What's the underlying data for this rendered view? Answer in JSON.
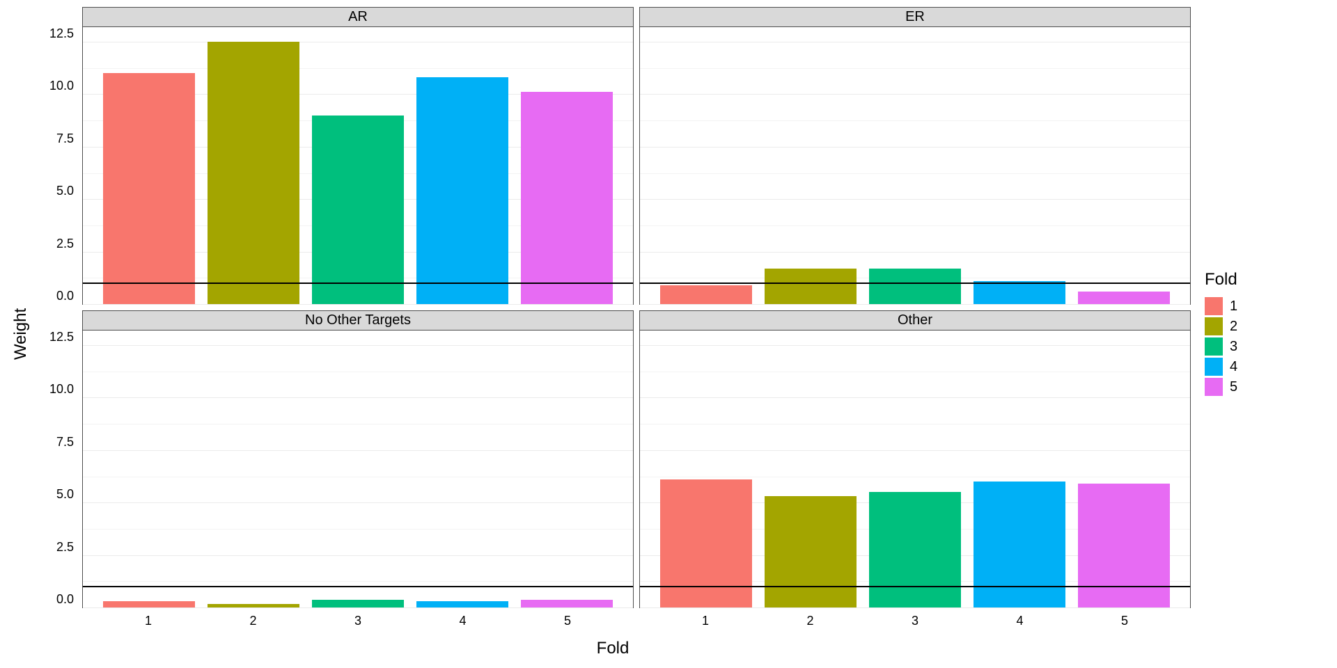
{
  "axis": {
    "x": "Fold",
    "y": "Weight"
  },
  "legend": {
    "title": "Fold",
    "items": [
      "1",
      "2",
      "3",
      "4",
      "5"
    ]
  },
  "colors": {
    "1": "#F8766D",
    "2": "#A3A500",
    "3": "#00BF7D",
    "4": "#00B0F6",
    "5": "#E76BF3"
  },
  "yticks": [
    "12.5",
    "10.0",
    "7.5",
    "5.0",
    "2.5",
    "0.0"
  ],
  "xticks": [
    "1",
    "2",
    "3",
    "4",
    "5"
  ],
  "chart_data": {
    "type": "bar",
    "facets": [
      "AR",
      "ER",
      "No Other Targets",
      "Other"
    ],
    "categories": [
      "1",
      "2",
      "3",
      "4",
      "5"
    ],
    "ylabel": "Weight",
    "xlabel": "Fold",
    "ylim": [
      0,
      13.2
    ],
    "hline": 1.0,
    "grid_major": [
      0,
      2.5,
      5.0,
      7.5,
      10.0,
      12.5
    ],
    "series": [
      {
        "facet": "AR",
        "values": [
          11.0,
          12.5,
          9.0,
          10.8,
          10.1
        ]
      },
      {
        "facet": "ER",
        "values": [
          0.9,
          1.7,
          1.7,
          1.1,
          0.6
        ]
      },
      {
        "facet": "No Other Targets",
        "values": [
          0.3,
          0.15,
          0.35,
          0.3,
          0.35
        ]
      },
      {
        "facet": "Other",
        "values": [
          6.1,
          5.3,
          5.5,
          6.0,
          5.9
        ]
      }
    ]
  }
}
